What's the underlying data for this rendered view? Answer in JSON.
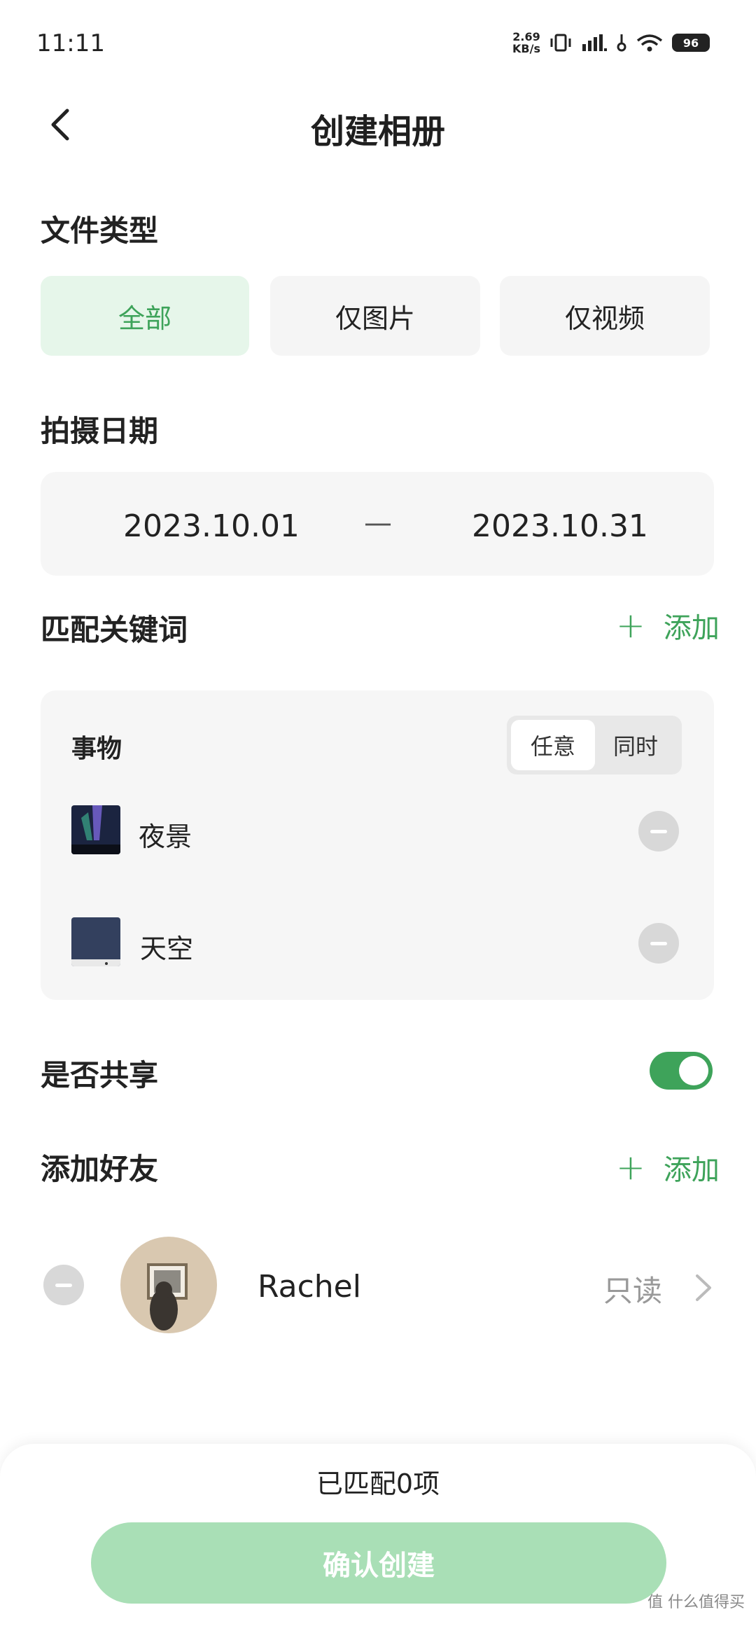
{
  "status_bar": {
    "time": "11:11",
    "net_speed_value": "2.69",
    "net_speed_unit": "KB/s",
    "battery": "96"
  },
  "header": {
    "title": "创建相册"
  },
  "file_type": {
    "label": "文件类型",
    "options": [
      "全部",
      "仅图片",
      "仅视频"
    ],
    "selected": "全部"
  },
  "date": {
    "label": "拍摄日期",
    "start": "2023.10.01",
    "separator": "—",
    "end": "2023.10.31"
  },
  "keywords": {
    "label": "匹配关键词",
    "add_label": "添加",
    "group_label": "事物",
    "match_modes": [
      "任意",
      "同时"
    ],
    "selected_mode": "任意",
    "items": [
      {
        "label": "夜景",
        "icon": "night-scene-thumbnail"
      },
      {
        "label": "天空",
        "icon": "sky-thumbnail"
      }
    ]
  },
  "share": {
    "label": "是否共享",
    "enabled": true
  },
  "friends": {
    "label": "添加好友",
    "add_label": "添加",
    "items": [
      {
        "name": "Rachel",
        "permission": "只读"
      }
    ]
  },
  "footer": {
    "matched_text": "已匹配0项",
    "confirm_label": "确认创建"
  },
  "watermark": "值 什么值得买",
  "colors": {
    "accent": "#3ea35a",
    "accent_light": "#e6f6ea",
    "confirm_disabled": "#a9dfb6"
  }
}
